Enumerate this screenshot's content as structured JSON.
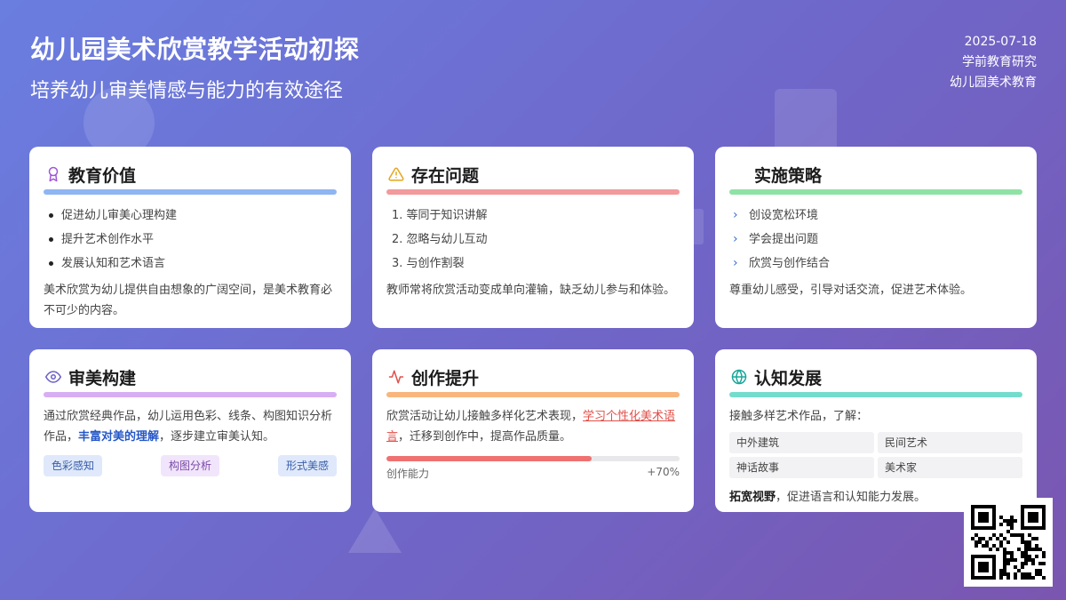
{
  "header": {
    "title": "幼儿园美术欣赏教学活动初探",
    "subtitle": "培养幼儿审美情感与能力的有效途径",
    "date": "2025-07-18",
    "category": "学前教育研究",
    "topic": "幼儿园美术教育"
  },
  "colors": {
    "value_bar": "#8fb5f3",
    "problem_bar": "#f29a9c",
    "strategy_bar": "#8fe2a6",
    "aesthetic_bar": "#d7aef3",
    "creation_bar": "#f8b67d",
    "cognition_bar": "#74dccd"
  },
  "cards": {
    "value": {
      "icon": "award-icon",
      "title": "教育价值",
      "items": [
        "促进幼儿审美心理构建",
        "提升艺术创作水平",
        "发展认知和艺术语言"
      ],
      "desc": "美术欣赏为幼儿提供自由想象的广阔空间，是美术教育必不可少的内容。"
    },
    "problem": {
      "icon": "warning-icon",
      "title": "存在问题",
      "items": [
        "1. 等同于知识讲解",
        "2. 忽略与幼儿互动",
        "3. 与创作割裂"
      ],
      "desc": "教师常将欣赏活动变成单向灌输，缺乏幼儿参与和体验。"
    },
    "strategy": {
      "title": "实施策略",
      "items": [
        "创设宽松环境",
        "学会提出问题",
        "欣赏与创作结合"
      ],
      "desc": "尊重幼儿感受，引导对话交流，促进艺术体验。"
    },
    "aesthetic": {
      "icon": "eye-icon",
      "title": "审美构建",
      "desc_pre": "通过欣赏经典作品，幼儿运用色彩、线条、构图知识分析作品，",
      "desc_highlight": "丰富对美的理解",
      "desc_post": "，逐步建立审美认知。",
      "tags": [
        "色彩感知",
        "构图分析",
        "形式美感"
      ]
    },
    "creation": {
      "icon": "activity-icon",
      "title": "创作提升",
      "desc_pre": "欣赏活动让幼儿接触多样化艺术表现，",
      "desc_link": "学习个性化美术语言",
      "desc_post": "，迁移到创作中，提高作品质量。",
      "progress_label": "创作能力",
      "progress_value": "+70%",
      "progress_fraction": 0.7
    },
    "cognition": {
      "icon": "globe-icon",
      "title": "认知发展",
      "intro": "接触多样艺术作品，了解：",
      "grid": [
        "中外建筑",
        "民间艺术",
        "神话故事",
        "美术家"
      ],
      "note_bold": "拓宽视野",
      "note_rest": "，促进语言和认知能力发展。"
    }
  }
}
